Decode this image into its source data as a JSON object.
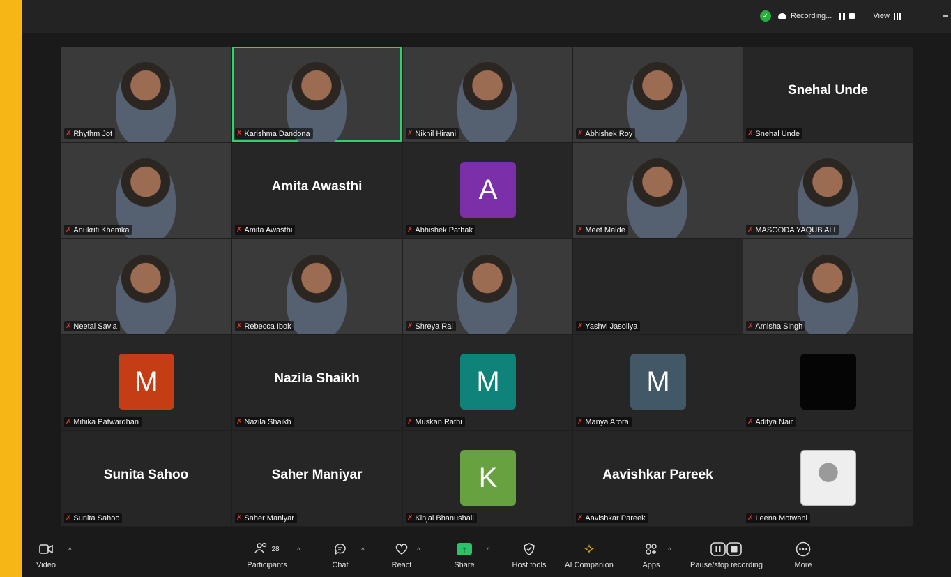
{
  "topbar": {
    "recording_label": "Recording...",
    "view_label": "View"
  },
  "tiles": [
    {
      "name": "Rhythm Jot",
      "type": "video",
      "bg": "bg-warm"
    },
    {
      "name": "Karishma Dandona",
      "type": "video",
      "bg": "bg-white",
      "active": true
    },
    {
      "name": "Nikhil Hirani",
      "type": "video",
      "bg": "bg-red"
    },
    {
      "name": "Abhishek Roy",
      "type": "video",
      "bg": "bg-dark"
    },
    {
      "name": "Snehal Unde",
      "type": "name",
      "display": "Snehal Unde"
    },
    {
      "name": "Anukriti Khemka",
      "type": "video",
      "bg": "bg-dark"
    },
    {
      "name": "Amita Awasthi",
      "type": "name",
      "display": "Amita Awasthi"
    },
    {
      "name": "Abhishek Pathak",
      "type": "avatar",
      "letter": "A",
      "color": "#7b2fa8"
    },
    {
      "name": "Meet Malde",
      "type": "video",
      "bg": "bg-room"
    },
    {
      "name": "MASOODA YAQUB ALI",
      "type": "video",
      "bg": "bg-pink"
    },
    {
      "name": "Neetal Savla",
      "type": "video",
      "bg": "bg-room"
    },
    {
      "name": "Rebecca Ibok",
      "type": "video",
      "bg": "bg-teal"
    },
    {
      "name": "Shreya Rai",
      "type": "video",
      "bg": "bg-grey"
    },
    {
      "name": "Yashvi Jasoliya",
      "type": "blank"
    },
    {
      "name": "Amisha Singh",
      "type": "video",
      "bg": "bg-dark"
    },
    {
      "name": "Mihika Patwardhan",
      "type": "avatar",
      "letter": "M",
      "color": "#c43d14"
    },
    {
      "name": "Nazila Shaikh",
      "type": "name",
      "display": "Nazila Shaikh"
    },
    {
      "name": "Muskan Rathi",
      "type": "avatar",
      "letter": "M",
      "color": "#0f8379"
    },
    {
      "name": "Manya Arora",
      "type": "avatar",
      "letter": "M",
      "color": "#425866"
    },
    {
      "name": "Aditya Nair",
      "type": "avatar",
      "letter": "",
      "color": "#050505"
    },
    {
      "name": "Sunita Sahoo",
      "type": "name",
      "display": "Sunita Sahoo"
    },
    {
      "name": "Saher Maniyar",
      "type": "name",
      "display": "Saher Maniyar"
    },
    {
      "name": "Kinjal Bhanushali",
      "type": "avatar",
      "letter": "K",
      "color": "#68a140"
    },
    {
      "name": "Aavishkar Pareek",
      "type": "name",
      "display": "Aavishkar Pareek"
    },
    {
      "name": "Leena Motwani",
      "type": "photo",
      "color": "#d8d8d8"
    }
  ],
  "toolbar": {
    "video": "Video",
    "participants": "Participants",
    "participants_count": "28",
    "chat": "Chat",
    "react": "React",
    "share": "Share",
    "host_tools": "Host tools",
    "ai_companion": "AI Companion",
    "apps": "Apps",
    "pause_stop": "Pause/stop recording",
    "more": "More"
  }
}
